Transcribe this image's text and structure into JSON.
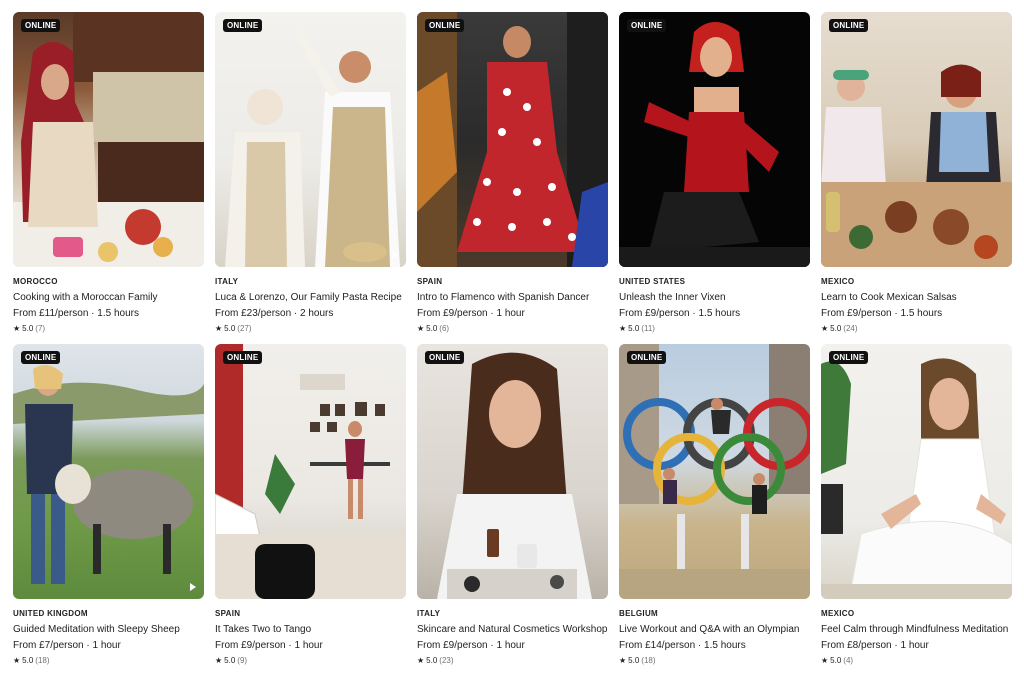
{
  "badge_label": "ONLINE",
  "rows": [
    [
      {
        "country": "MOROCCO",
        "title": "Cooking with a Moroccan Family",
        "price": "From £11/person · 1.5 hours",
        "rating": "5.0",
        "count": "(7)",
        "image": "woman-cooking-moroccan-kitchen",
        "video": false
      },
      {
        "country": "ITALY",
        "title": "Luca & Lorenzo, Our Family Pasta Recipe",
        "price": "From £23/person · 2 hours",
        "rating": "5.0",
        "count": "(27)",
        "image": "two-chefs-flour-fight",
        "video": true
      },
      {
        "country": "SPAIN",
        "title": "Intro to Flamenco with Spanish Dancer",
        "price": "From £9/person · 1 hour",
        "rating": "5.0",
        "count": "(6)",
        "image": "flamenco-dancer-polka-dot-dress",
        "video": false
      },
      {
        "country": "UNITED STATES",
        "title": "Unleash the Inner Vixen",
        "price": "From £9/person · 1.5 hours",
        "rating": "5.0",
        "count": "(11)",
        "image": "burlesque-performer-red-corset",
        "video": false
      },
      {
        "country": "MEXICO",
        "title": "Learn to Cook Mexican Salsas",
        "price": "From £9/person · 1.5 hours",
        "rating": "5.0",
        "count": "(24)",
        "image": "two-women-preparing-salsas",
        "video": false
      }
    ],
    [
      {
        "country": "UNITED KINGDOM",
        "title": "Guided Meditation with Sleepy Sheep",
        "price": "From £7/person · 1 hour",
        "rating": "5.0",
        "count": "(18)",
        "image": "woman-with-sheep-on-hill",
        "video": true
      },
      {
        "country": "SPAIN",
        "title": "It Takes Two to Tango",
        "price": "From £9/person · 1 hour",
        "rating": "5.0",
        "count": "(9)",
        "image": "dancer-in-studio",
        "video": false
      },
      {
        "country": "ITALY",
        "title": "Skincare and Natural Cosmetics Workshop",
        "price": "From £9/person · 1 hour",
        "rating": "5.0",
        "count": "(23)",
        "image": "woman-with-cosmetics",
        "video": false
      },
      {
        "country": "BELGIUM",
        "title": "Live Workout and Q&A with an Olympian",
        "price": "From £14/person · 1.5 hours",
        "rating": "5.0",
        "count": "(18)",
        "image": "people-on-olympic-rings",
        "video": false
      },
      {
        "country": "MEXICO",
        "title": "Feel Calm through Mindfulness Meditation",
        "price": "From £8/person · 1 hour",
        "rating": "5.0",
        "count": "(4)",
        "image": "woman-meditating-white-dress",
        "video": false
      }
    ]
  ]
}
